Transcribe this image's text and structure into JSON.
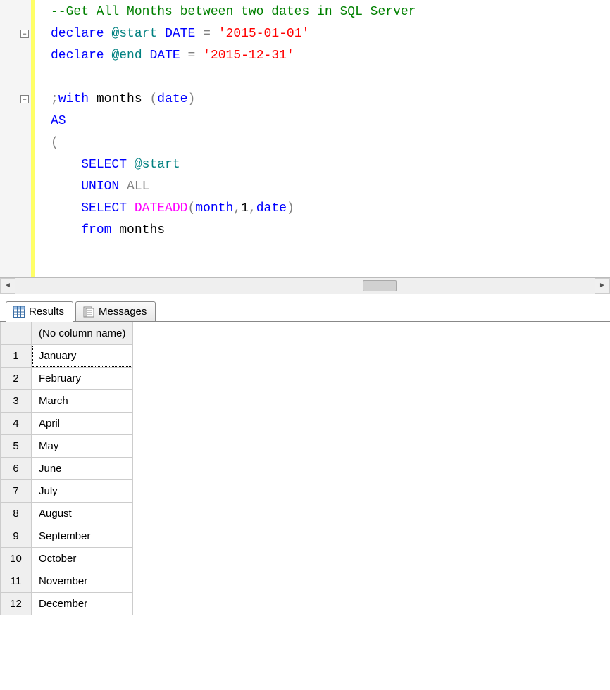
{
  "editor": {
    "lines": [
      [
        {
          "cls": "tk-comment",
          "text": "--Get All Months between two dates in SQL Server"
        }
      ],
      [
        {
          "cls": "tk-keyword",
          "text": "declare"
        },
        {
          "cls": "tk-black",
          "text": " "
        },
        {
          "cls": "tk-var",
          "text": "@start"
        },
        {
          "cls": "tk-black",
          "text": " "
        },
        {
          "cls": "tk-keyword",
          "text": "DATE"
        },
        {
          "cls": "tk-black",
          "text": " "
        },
        {
          "cls": "tk-gray",
          "text": "="
        },
        {
          "cls": "tk-black",
          "text": " "
        },
        {
          "cls": "tk-string",
          "text": "'2015-01-01'"
        }
      ],
      [
        {
          "cls": "tk-keyword",
          "text": "declare"
        },
        {
          "cls": "tk-black",
          "text": " "
        },
        {
          "cls": "tk-var",
          "text": "@end"
        },
        {
          "cls": "tk-black",
          "text": " "
        },
        {
          "cls": "tk-keyword",
          "text": "DATE"
        },
        {
          "cls": "tk-black",
          "text": " "
        },
        {
          "cls": "tk-gray",
          "text": "="
        },
        {
          "cls": "tk-black",
          "text": " "
        },
        {
          "cls": "tk-string",
          "text": "'2015-12-31'"
        }
      ],
      [],
      [
        {
          "cls": "tk-gray",
          "text": ";"
        },
        {
          "cls": "tk-keyword",
          "text": "with"
        },
        {
          "cls": "tk-black",
          "text": " months "
        },
        {
          "cls": "tk-gray",
          "text": "("
        },
        {
          "cls": "tk-keyword",
          "text": "date"
        },
        {
          "cls": "tk-gray",
          "text": ")"
        }
      ],
      [
        {
          "cls": "tk-keyword",
          "text": "AS"
        }
      ],
      [
        {
          "cls": "tk-gray",
          "text": "("
        }
      ],
      [
        {
          "cls": "tk-black",
          "text": "    "
        },
        {
          "cls": "tk-keyword",
          "text": "SELECT"
        },
        {
          "cls": "tk-black",
          "text": " "
        },
        {
          "cls": "tk-var",
          "text": "@start"
        }
      ],
      [
        {
          "cls": "tk-black",
          "text": "    "
        },
        {
          "cls": "tk-keyword",
          "text": "UNION"
        },
        {
          "cls": "tk-black",
          "text": " "
        },
        {
          "cls": "tk-gray",
          "text": "ALL"
        }
      ],
      [
        {
          "cls": "tk-black",
          "text": "    "
        },
        {
          "cls": "tk-keyword",
          "text": "SELECT"
        },
        {
          "cls": "tk-black",
          "text": " "
        },
        {
          "cls": "tk-func",
          "text": "DATEADD"
        },
        {
          "cls": "tk-gray",
          "text": "("
        },
        {
          "cls": "tk-keyword",
          "text": "month"
        },
        {
          "cls": "tk-gray",
          "text": ","
        },
        {
          "cls": "tk-black",
          "text": "1"
        },
        {
          "cls": "tk-gray",
          "text": ","
        },
        {
          "cls": "tk-keyword",
          "text": "date"
        },
        {
          "cls": "tk-gray",
          "text": ")"
        }
      ],
      [
        {
          "cls": "tk-black",
          "text": "    "
        },
        {
          "cls": "tk-keyword",
          "text": "from"
        },
        {
          "cls": "tk-black",
          "text": " months"
        }
      ]
    ],
    "fold_markers": [
      {
        "line": 1,
        "glyph": "−"
      },
      {
        "line": 4,
        "glyph": "−"
      }
    ]
  },
  "scrollbar": {
    "left_glyph": "◄",
    "right_glyph": "►"
  },
  "tabs": {
    "results": "Results",
    "messages": "Messages"
  },
  "results": {
    "header": "(No column name)",
    "rows": [
      {
        "n": "1",
        "v": "January"
      },
      {
        "n": "2",
        "v": "February"
      },
      {
        "n": "3",
        "v": "March"
      },
      {
        "n": "4",
        "v": "April"
      },
      {
        "n": "5",
        "v": "May"
      },
      {
        "n": "6",
        "v": "June"
      },
      {
        "n": "7",
        "v": "July"
      },
      {
        "n": "8",
        "v": "August"
      },
      {
        "n": "9",
        "v": "September"
      },
      {
        "n": "10",
        "v": "October"
      },
      {
        "n": "11",
        "v": "November"
      },
      {
        "n": "12",
        "v": "December"
      }
    ]
  }
}
